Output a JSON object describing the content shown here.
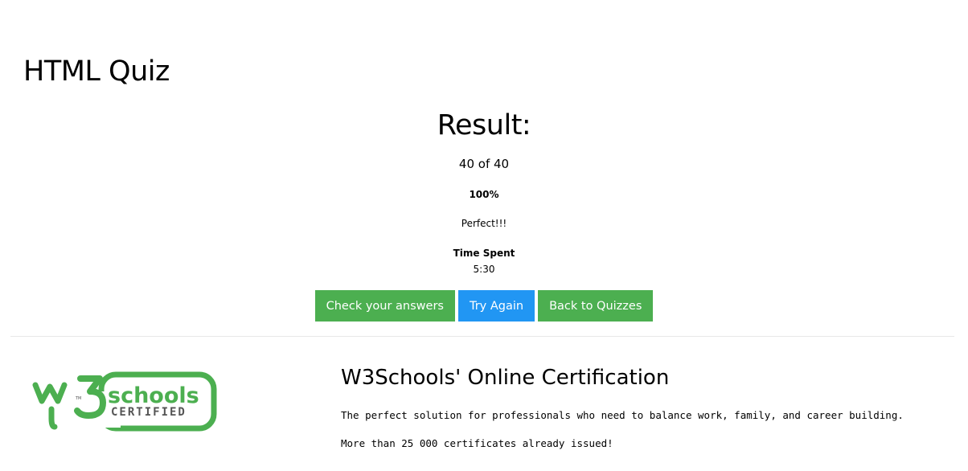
{
  "quiz": {
    "title": "HTML Quiz"
  },
  "result": {
    "heading": "Result:",
    "score": "40 of 40",
    "percent": "100%",
    "verdict": "Perfect!!!",
    "time_label": "Time Spent",
    "time_value": "5:30"
  },
  "buttons": {
    "check_answers": "Check your answers",
    "try_again": "Try Again",
    "back_to_quizzes": "Back to Quizzes"
  },
  "certification": {
    "logo_text_main": "w3schools",
    "logo_text_sub": "CERTIFIED",
    "logo_tm": "TM",
    "title": "W3Schools' Online Certification",
    "description": "The perfect solution for professionals who need to balance work, family, and career building.",
    "issued": "More than 25 000 certificates already issued!"
  },
  "colors": {
    "green": "#4caf50",
    "blue": "#2196f3",
    "logo_green": "#4caf50"
  }
}
